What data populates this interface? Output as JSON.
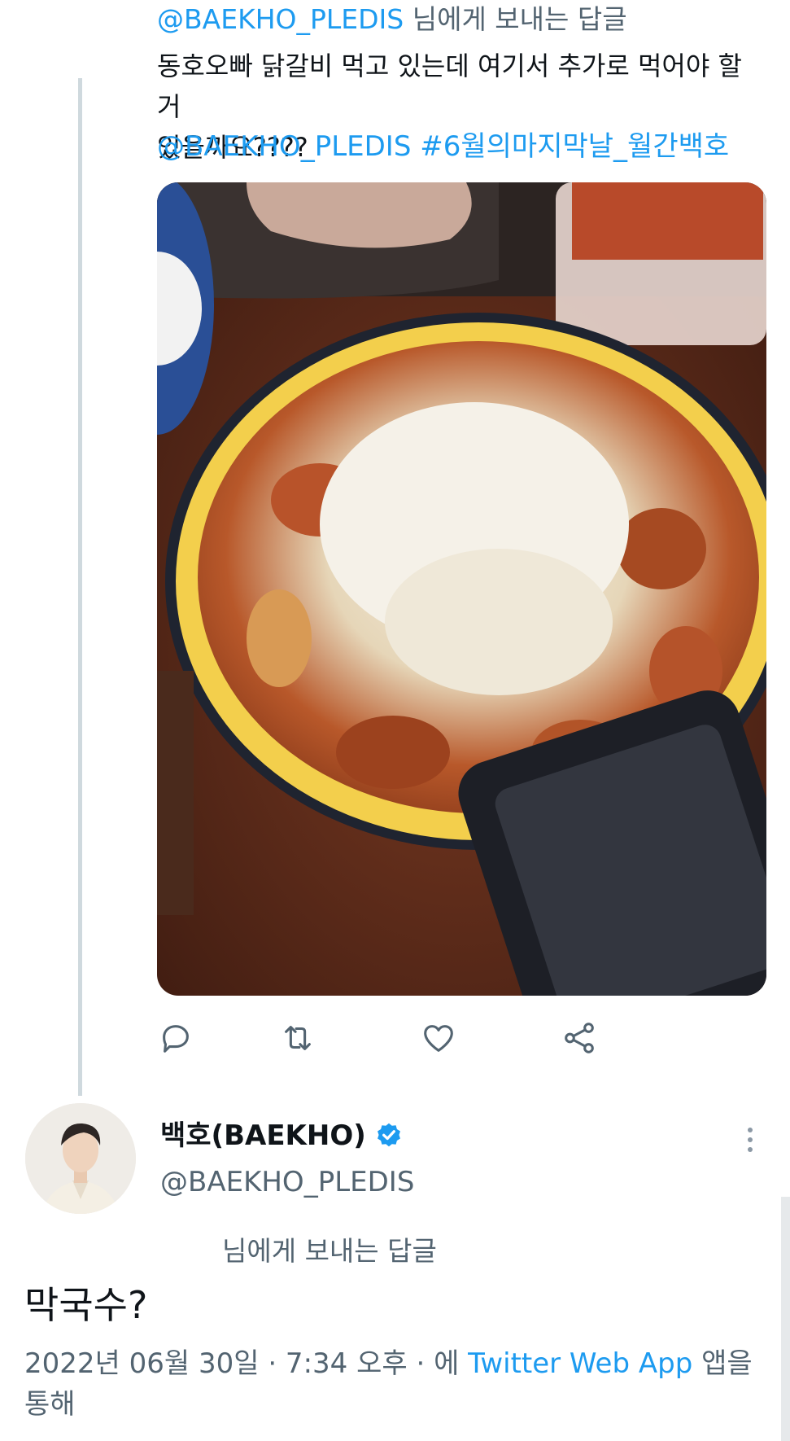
{
  "original_tweet": {
    "reply_to_handle": "@BAEKHO_PLEDIS",
    "reply_to_suffix": " 님에게 보내는 답글",
    "text_line1": "동호오빠 닭갈비 먹고 있는데 여기서 추가로 먹어야 할 거",
    "text_line2": "있을까요????",
    "mention": "@BAEKHO_PLEDIS",
    "hashtag": "#6월의마지막날_월간백호",
    "photo_label": "dakgalbi-photo"
  },
  "actions": {
    "reply_icon": "reply-icon",
    "retweet_icon": "retweet-icon",
    "like_icon": "heart-icon",
    "share_icon": "share-icon"
  },
  "reply_tweet": {
    "display_name": "백호(BAEKHO)",
    "handle": "@BAEKHO_PLEDIS",
    "reply_to_suffix": "님에게 보내는 답글",
    "text": "막국수?",
    "date": "2022년 06월 30일 · 7:34 오후 · 에",
    "client": "Twitter Web App",
    "client_suffix": "앱을",
    "client_suffix_line2": "통해"
  },
  "colors": {
    "link": "#1d9bf0",
    "secondary_text": "#536471",
    "primary_text": "#0f1419",
    "thread_line": "#cfd9de"
  }
}
